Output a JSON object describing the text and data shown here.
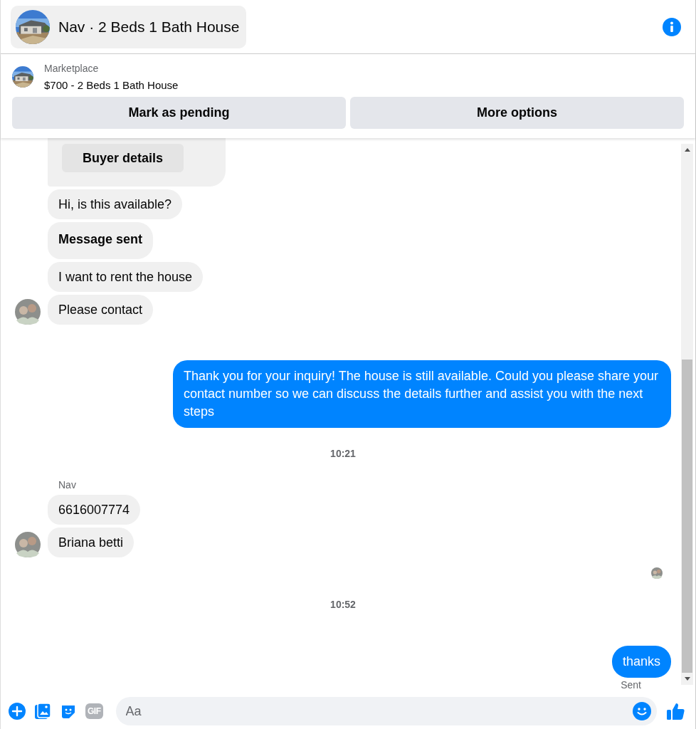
{
  "header": {
    "title": "Nav · 2 Beds 1 Bath House"
  },
  "listing": {
    "source": "Marketplace",
    "title": "$700 - 2 Beds 1 Bath House",
    "buttons": [
      "Mark as pending",
      "More options"
    ]
  },
  "messages": [
    {
      "kind": "card",
      "button": "Buyer details"
    },
    {
      "kind": "in",
      "text": "Hi, is this available?",
      "bold": false,
      "avatar": false
    },
    {
      "kind": "in",
      "text": "Message sent",
      "bold": true,
      "avatar": false
    },
    {
      "kind": "in",
      "text": "I want to rent the house",
      "bold": false,
      "avatar": false
    },
    {
      "kind": "in",
      "text": "Please contact",
      "bold": false,
      "avatar": true
    },
    {
      "kind": "out",
      "text": "Thank you for your inquiry! The house is still available. Could you please share your contact number so we can discuss the details further and assist you with the next steps"
    },
    {
      "kind": "time",
      "text": "10:21"
    },
    {
      "kind": "sender",
      "text": "Nav"
    },
    {
      "kind": "in",
      "text": "6616007774",
      "bold": false,
      "avatar": false
    },
    {
      "kind": "in",
      "text": "Briana betti",
      "bold": false,
      "avatar": true
    },
    {
      "kind": "seen"
    },
    {
      "kind": "time",
      "text": "10:52"
    },
    {
      "kind": "out",
      "text": "thanks"
    },
    {
      "kind": "status",
      "text": "Sent"
    }
  ],
  "composer": {
    "placeholder": "Aa",
    "gif_label": "GIF"
  }
}
